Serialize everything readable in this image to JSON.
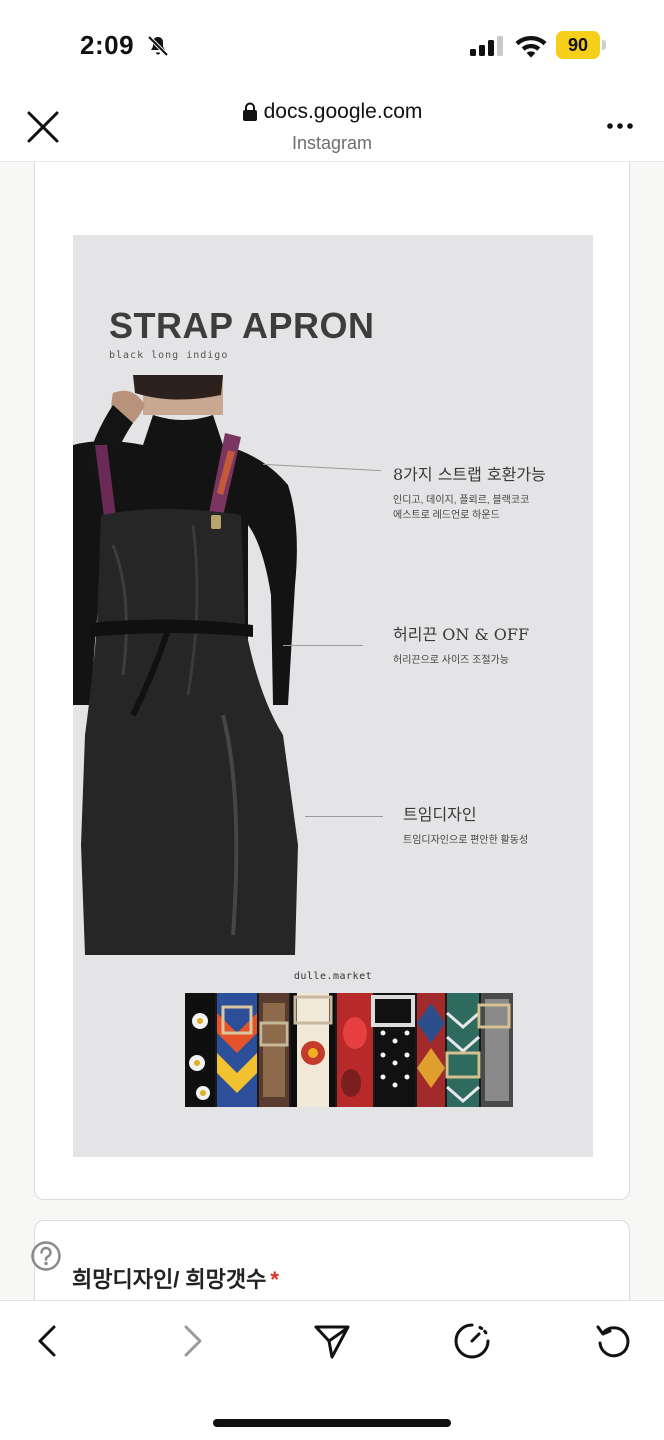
{
  "status_bar": {
    "time": "2:09",
    "battery_level": "90",
    "battery_color": "#f5cf19"
  },
  "browser": {
    "url": "docs.google.com",
    "source": "Instagram"
  },
  "poster": {
    "title": "STRAP APRON",
    "subtitle": "black long indigo",
    "features": [
      {
        "title": "8가지 스트랩 호환가능",
        "desc": [
          "인디고, 데이지, 플뢰르, 블랙코코",
          "에스트로 레드언로 하운드"
        ]
      },
      {
        "title": "허리끈 ON & OFF",
        "desc": [
          "허리끈으로 사이즈 조절가능"
        ]
      },
      {
        "title": "트임디자인",
        "desc": [
          "트임디자인으로 편안한 활동성"
        ]
      }
    ],
    "brand": "dulle.market"
  },
  "question": {
    "label": "희망디자인/ 희망갯수",
    "required_mark": "*"
  },
  "icons": {
    "status": [
      "mute-icon",
      "signal-icon",
      "wifi-icon"
    ],
    "header": [
      "close-icon",
      "lock-icon",
      "more-icon"
    ],
    "toolbar": [
      "back-icon",
      "forward-icon",
      "send-icon",
      "timer-icon",
      "refresh-icon"
    ],
    "form": [
      "help-icon"
    ]
  }
}
